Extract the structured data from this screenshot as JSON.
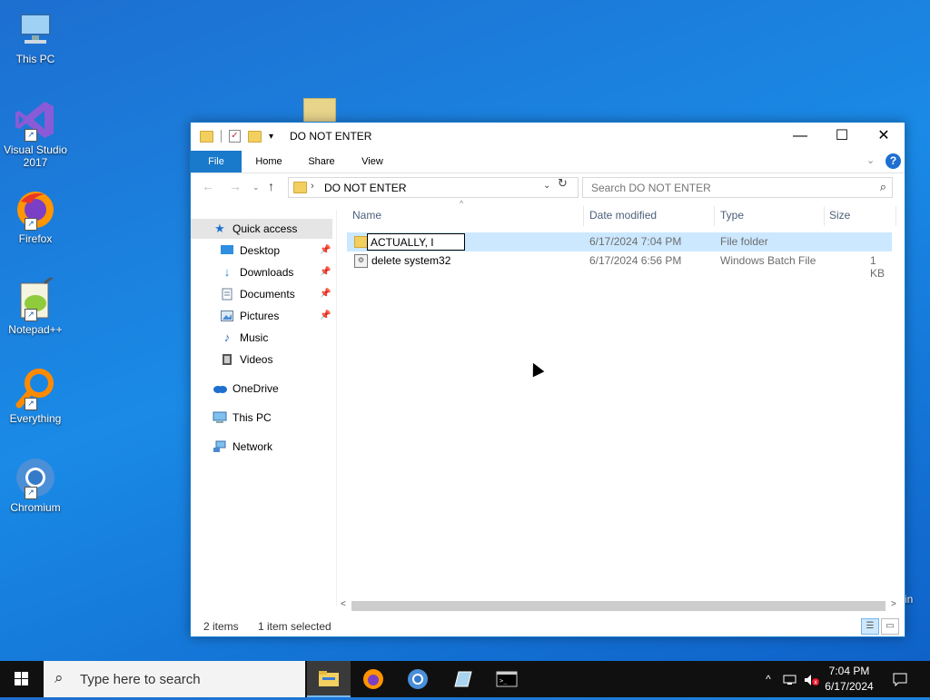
{
  "desktop": {
    "icons": [
      {
        "label": "This PC"
      },
      {
        "label": "Visual Studio 2017"
      },
      {
        "label": "Firefox"
      },
      {
        "label": "Notepad++"
      },
      {
        "label": "Everything"
      },
      {
        "label": "Chromium"
      }
    ],
    "partial_text": "in"
  },
  "window": {
    "title": "DO NOT ENTER",
    "controls": {
      "minimize": "—",
      "maximize": "☐",
      "close": "✕"
    },
    "ribbon_tabs": [
      "File",
      "Home",
      "Share",
      "View"
    ],
    "address": {
      "crumb": "DO NOT ENTER"
    },
    "search": {
      "placeholder": "Search DO NOT ENTER"
    },
    "nav_pane": {
      "quick_access": "Quick access",
      "items": [
        {
          "label": "Desktop",
          "pinned": true
        },
        {
          "label": "Downloads",
          "pinned": true
        },
        {
          "label": "Documents",
          "pinned": true
        },
        {
          "label": "Pictures",
          "pinned": true
        },
        {
          "label": "Music",
          "pinned": false
        },
        {
          "label": "Videos",
          "pinned": false
        }
      ],
      "onedrive": "OneDrive",
      "this_pc": "This PC",
      "network": "Network"
    },
    "columns": {
      "name": "Name",
      "date": "Date modified",
      "type": "Type",
      "size": "Size"
    },
    "files": [
      {
        "name": "ACTUALLY, I",
        "date": "6/17/2024 7:04 PM",
        "type": "File folder",
        "size": "",
        "renaming": true
      },
      {
        "name": "delete system32",
        "date": "6/17/2024 6:56 PM",
        "type": "Windows Batch File",
        "size": "1 KB",
        "renaming": false
      }
    ],
    "status": {
      "count": "2 items",
      "selection": "1 item selected"
    }
  },
  "taskbar": {
    "search_placeholder": "Type here to search",
    "clock": {
      "time": "7:04 PM",
      "date": "6/17/2024"
    }
  },
  "colors": {
    "accent": "#1979ca",
    "selection": "#cce8ff",
    "taskbar": "#101010"
  }
}
